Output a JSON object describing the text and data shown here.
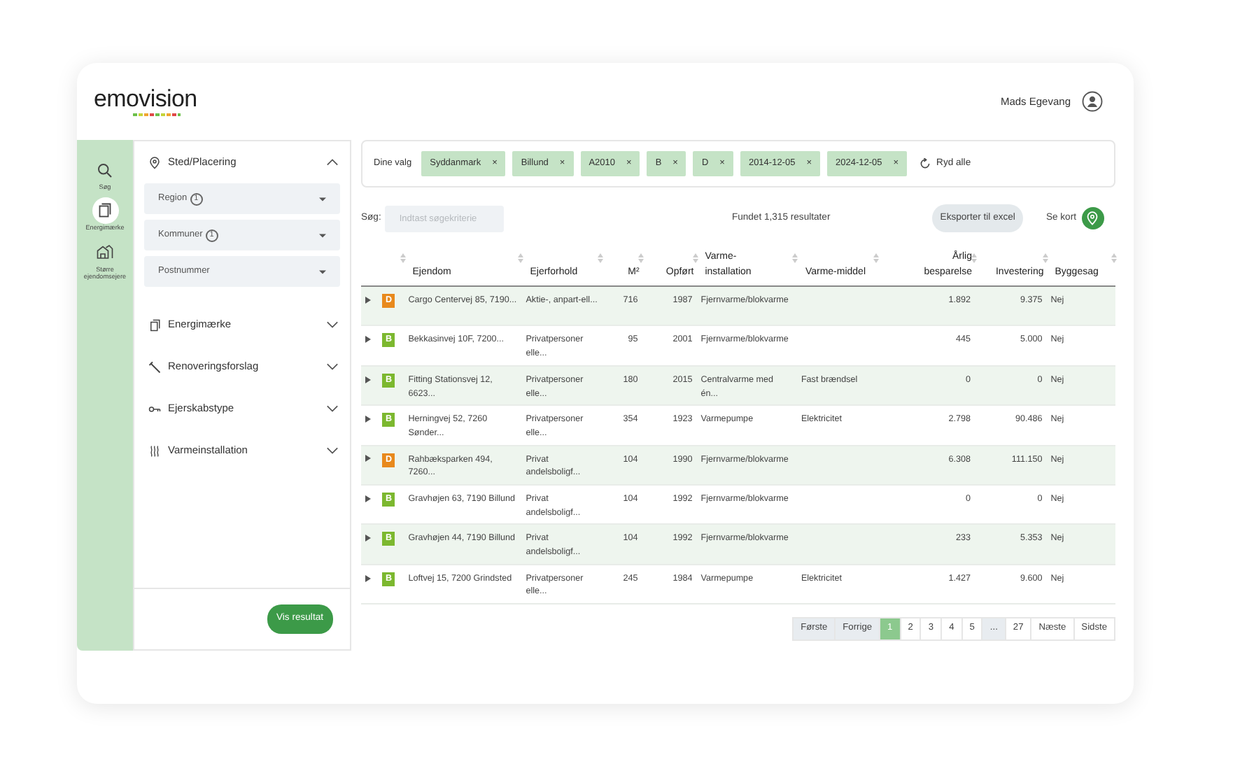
{
  "header": {
    "logo": "emovision",
    "user_name": "Mads Egevang"
  },
  "rail": {
    "items": [
      {
        "label": "Søg",
        "selected": false
      },
      {
        "label": "Energimærke",
        "selected": true
      },
      {
        "label": "Større ejendomsejere",
        "selected": false
      }
    ]
  },
  "filters": {
    "sections": [
      {
        "label": "Sted/Placering",
        "expanded": true,
        "dropdowns": [
          {
            "label": "Region",
            "count": "1"
          },
          {
            "label": "Kommuner",
            "count": "1"
          },
          {
            "label": "Postnummer"
          }
        ]
      },
      {
        "label": "Energimærke",
        "expanded": false
      },
      {
        "label": "Renoveringsforslag",
        "expanded": false
      },
      {
        "label": "Ejerskabstype",
        "expanded": false
      },
      {
        "label": "Varmeinstallation",
        "expanded": false
      }
    ],
    "apply_button": "Vis resultat"
  },
  "choices": {
    "label": "Dine valg",
    "chips": [
      "Syddanmark",
      "Billund",
      "A2010",
      "B",
      "D",
      "2014-12-05",
      "2024-12-05"
    ],
    "remove_mark": "×",
    "clear": "Ryd alle"
  },
  "toolbar": {
    "search_label": "Søg:",
    "search": {
      "placeholder": "Indtast søgekriterie"
    },
    "results": "Fundet 1,315 resultater",
    "export_button": "Eksporter til excel",
    "map_label": "Se kort"
  },
  "table": {
    "columns": [
      "",
      "",
      "Ejendom",
      "Ejerforhold",
      "M²",
      "Opført",
      "Varme-installation",
      "Varme-middel",
      "Årlig besparelse",
      "Investering",
      "Byggesag"
    ],
    "rows": [
      {
        "label": "D",
        "color": "#e8891c",
        "cells": [
          "",
          "",
          "Cargo Centervej 85, 7190...",
          "Aktie-, anpart-ell...",
          "716",
          "1987",
          "Fjernvarme/blokvarme",
          "",
          "1.892",
          "9.375",
          "Nej"
        ]
      },
      {
        "label": "B",
        "color": "#7cb82f",
        "cells": [
          "",
          "",
          "Bekkasinvej 10F, 7200...",
          "Privatpersoner elle...",
          "95",
          "2001",
          "Fjernvarme/blokvarme",
          "",
          "445",
          "5.000",
          "Nej"
        ]
      },
      {
        "label": "B",
        "color": "#7cb82f",
        "cells": [
          "",
          "",
          "Fitting Stationsvej 12, 6623...",
          "Privatpersoner elle...",
          "180",
          "2015",
          "Centralvarme med én...",
          "Fast brændsel",
          "0",
          "0",
          "Nej"
        ]
      },
      {
        "label": "B",
        "color": "#7cb82f",
        "cells": [
          "",
          "",
          "Herningvej 52, 7260 Sønder...",
          "Privatpersoner elle...",
          "354",
          "1923",
          "Varmepumpe",
          "Elektricitet",
          "2.798",
          "90.486",
          "Nej"
        ]
      },
      {
        "label": "D",
        "color": "#e8891c",
        "cells": [
          "",
          "",
          "Rahbæksparken 494, 7260...",
          "Privat andelsboligf...",
          "104",
          "1990",
          "Fjernvarme/blokvarme",
          "",
          "6.308",
          "111.150",
          "Nej"
        ]
      },
      {
        "label": "B",
        "color": "#7cb82f",
        "cells": [
          "",
          "",
          "Gravhøjen 63, 7190 Billund",
          "Privat andelsboligf...",
          "104",
          "1992",
          "Fjernvarme/blokvarme",
          "",
          "0",
          "0",
          "Nej"
        ]
      },
      {
        "label": "B",
        "color": "#7cb82f",
        "cells": [
          "",
          "",
          "Gravhøjen 44, 7190 Billund",
          "Privat andelsboligf...",
          "104",
          "1992",
          "Fjernvarme/blokvarme",
          "",
          "233",
          "5.353",
          "Nej"
        ]
      },
      {
        "label": "B",
        "color": "#7cb82f",
        "cells": [
          "",
          "",
          "Loftvej 15, 7200 Grindsted",
          "Privatpersoner elle...",
          "245",
          "1984",
          "Varmepumpe",
          "Elektricitet",
          "1.427",
          "9.600",
          "Nej"
        ]
      }
    ]
  },
  "pagination": [
    {
      "label": "Første",
      "selected": false,
      "disabled": true
    },
    {
      "label": "Forrige",
      "selected": false,
      "disabled": true
    },
    {
      "label": "1",
      "selected": true,
      "disabled": false
    },
    {
      "label": "2",
      "selected": false,
      "disabled": false
    },
    {
      "label": "3",
      "selected": false,
      "disabled": false
    },
    {
      "label": "4",
      "selected": false,
      "disabled": false
    },
    {
      "label": "5",
      "selected": false,
      "disabled": false
    },
    {
      "label": "...",
      "selected": false,
      "disabled": true
    },
    {
      "label": "27",
      "selected": false,
      "disabled": false
    },
    {
      "label": "Næste",
      "selected": false,
      "disabled": false
    },
    {
      "label": "Sidste",
      "selected": false,
      "disabled": false
    }
  ]
}
